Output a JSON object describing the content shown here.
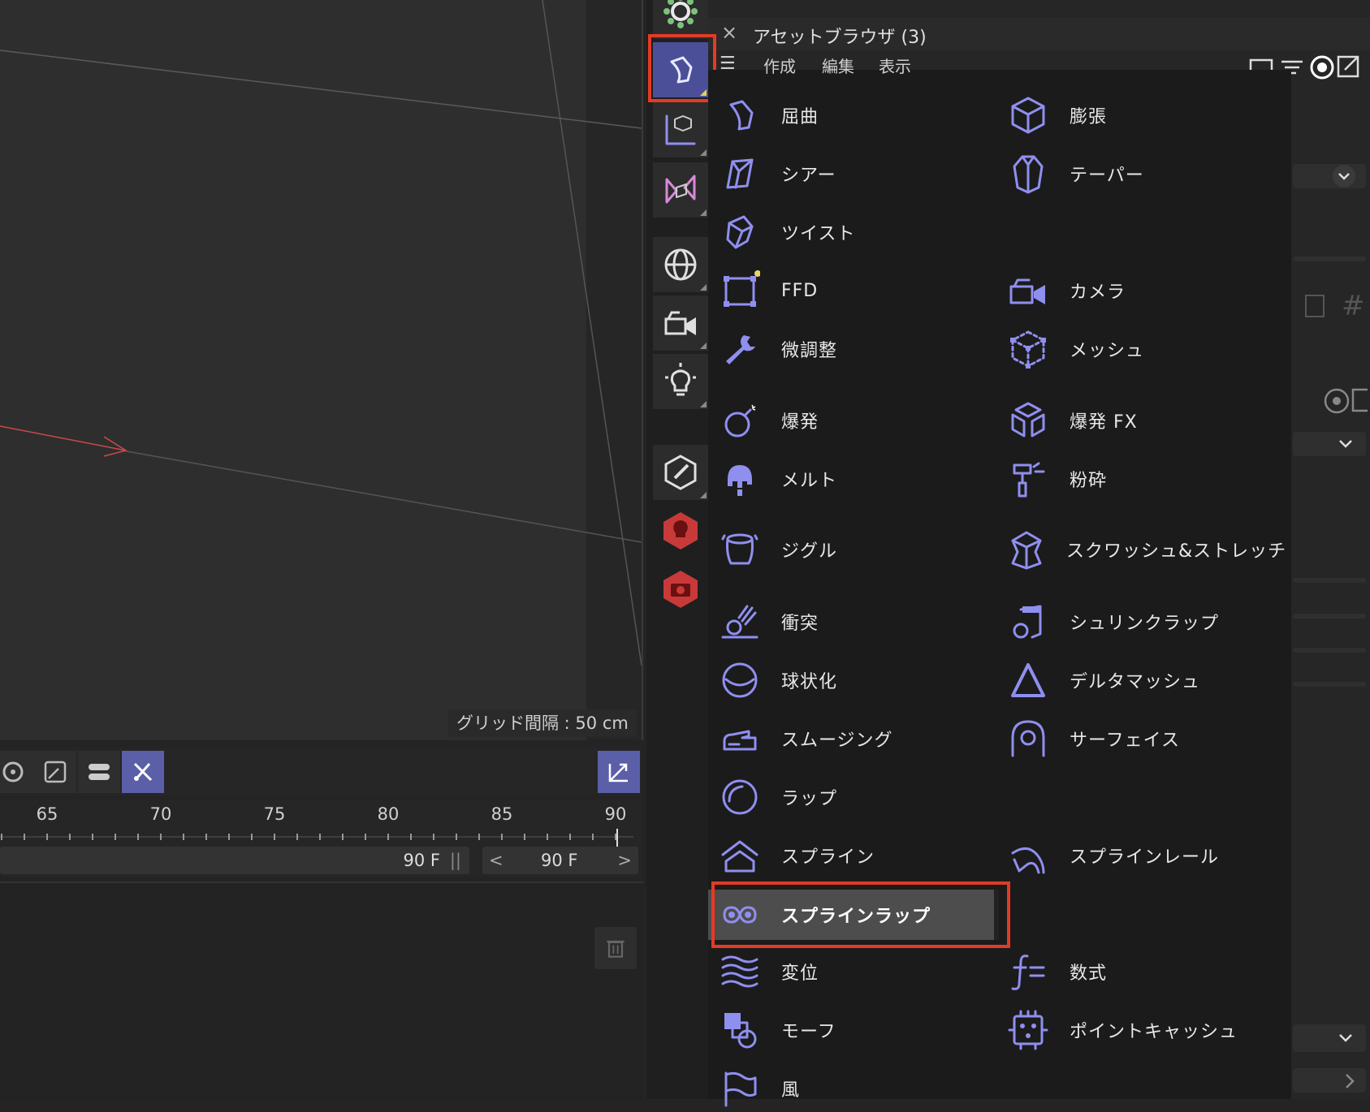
{
  "viewport": {
    "grid_label": "グリッド間隔 : 50 cm"
  },
  "timeline": {
    "ticks": [
      "65",
      "70",
      "75",
      "80",
      "85",
      "90"
    ],
    "frame_left": "90 F",
    "frame_right": "90 F",
    "prev_arrow": "<",
    "next_arrow": ">"
  },
  "asset_browser": {
    "title": "アセットブラウザ (3)",
    "close": "×",
    "menu": [
      "作成",
      "編集",
      "表示"
    ]
  },
  "deformer_menu": {
    "left_column": [
      {
        "label": "屈曲",
        "icon": "bend-icon"
      },
      {
        "label": "シアー",
        "icon": "shear-icon"
      },
      {
        "label": "ツイスト",
        "icon": "twist-icon"
      },
      {
        "label": "FFD",
        "icon": "ffd-icon"
      },
      {
        "label": "微調整",
        "icon": "correction-icon"
      },
      {
        "label": "爆発",
        "icon": "explosion-icon"
      },
      {
        "label": "メルト",
        "icon": "melt-icon"
      },
      {
        "label": "ジグル",
        "icon": "jiggle-icon"
      },
      {
        "label": "衝突",
        "icon": "collision-icon"
      },
      {
        "label": "球状化",
        "icon": "spherify-icon"
      },
      {
        "label": "スムージング",
        "icon": "smoothing-icon"
      },
      {
        "label": "ラップ",
        "icon": "wrap-icon"
      },
      {
        "label": "スプライン",
        "icon": "spline-icon"
      },
      {
        "label": "スプラインラップ",
        "icon": "spline-wrap-icon",
        "highlighted": true
      },
      {
        "label": "変位",
        "icon": "displacer-icon"
      },
      {
        "label": "モーフ",
        "icon": "morph-icon"
      },
      {
        "label": "風",
        "icon": "wind-icon"
      }
    ],
    "right_column": [
      {
        "label": "膨張",
        "icon": "bulge-icon"
      },
      {
        "label": "テーパー",
        "icon": "taper-icon"
      },
      {
        "label": "カメラ",
        "icon": "camera-icon"
      },
      {
        "label": "メッシュ",
        "icon": "mesh-icon"
      },
      {
        "label": "爆発 FX",
        "icon": "explosion-fx-icon"
      },
      {
        "label": "粉砕",
        "icon": "shatter-icon"
      },
      {
        "label": "スクワッシュ&ストレッチ",
        "icon": "squash-stretch-icon"
      },
      {
        "label": "シュリンクラップ",
        "icon": "shrink-wrap-icon"
      },
      {
        "label": "デルタマッシュ",
        "icon": "delta-mush-icon"
      },
      {
        "label": "サーフェイス",
        "icon": "surface-icon"
      },
      {
        "label": "スプラインレール",
        "icon": "spline-rail-icon"
      },
      {
        "label": "数式",
        "icon": "formula-icon"
      },
      {
        "label": "ポイントキャッシュ",
        "icon": "point-cache-icon"
      }
    ]
  },
  "colors": {
    "icon_accent": "#8f8ff0",
    "highlight_border": "#e23b26",
    "selected_tool": "#4a4f98"
  }
}
